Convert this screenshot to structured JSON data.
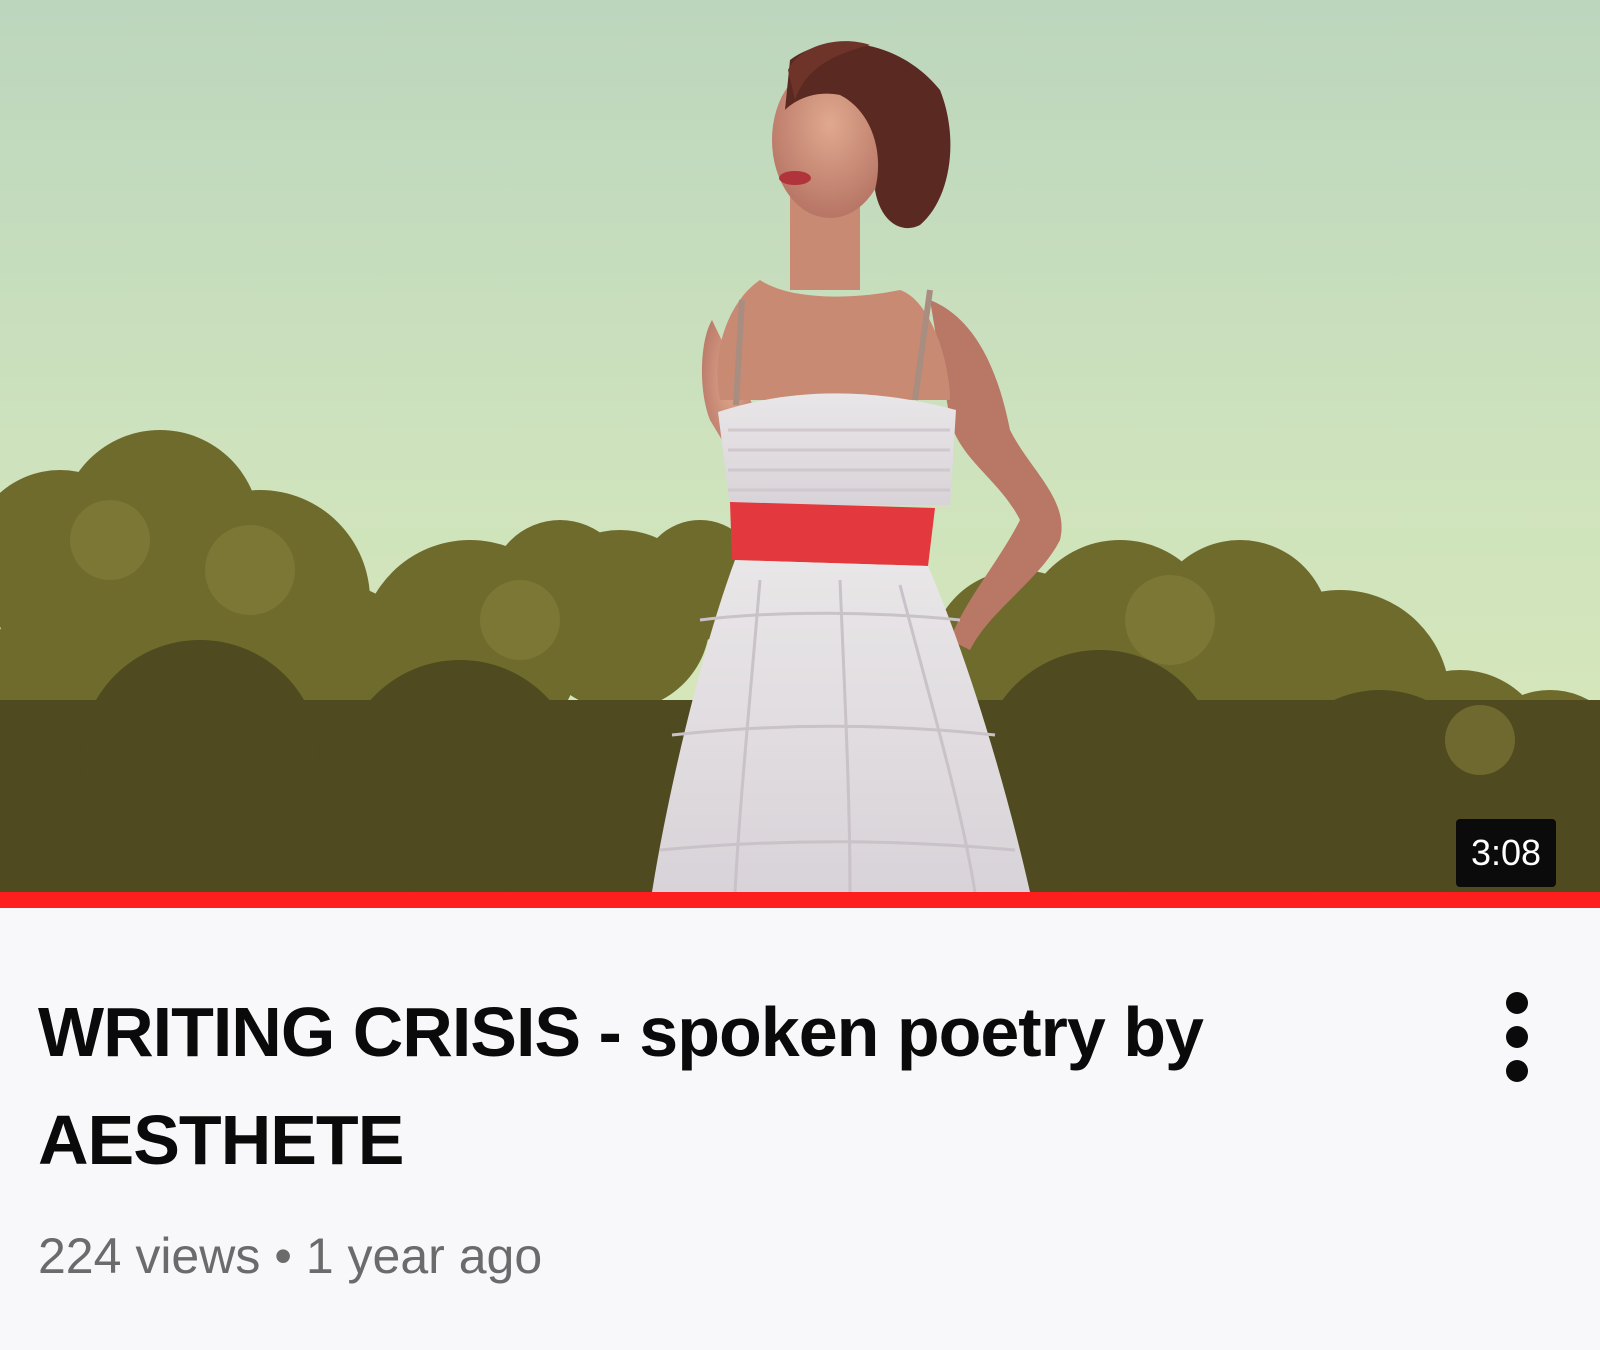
{
  "video": {
    "duration": "3:08",
    "title": "WRITING CRISIS - spoken poetry by AESTHETE",
    "views": "224 views",
    "separator": "•",
    "age": "1 year ago",
    "watched_fraction": 1.0
  },
  "icons": {
    "menu": "more-vertical-icon"
  },
  "colors": {
    "progress": "#ff1e1e",
    "title": "#0a0a0a",
    "meta": "#6b6b6b",
    "background": "#f8f8fa",
    "duration_badge": "#0b0b0b"
  }
}
